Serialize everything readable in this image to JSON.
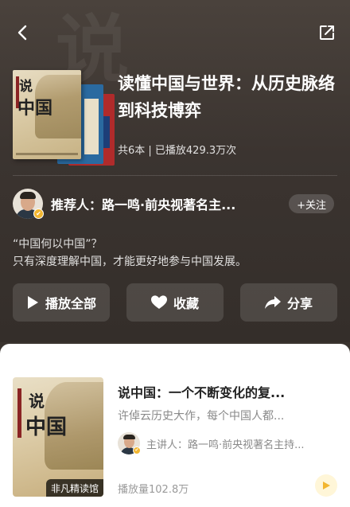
{
  "header": {
    "watermark": "说",
    "back_icon": "chevron-left-icon",
    "share_icon": "share-export-icon"
  },
  "album": {
    "title": "读懂中国与世界：从历史脉络到科技博弈",
    "meta": "共6本 | 已播放429.3万次",
    "cover_title_line1": "说",
    "cover_title_line2": "中国"
  },
  "recommender": {
    "label": "推荐人：路一鸣·前央视著名主...",
    "follow_label": "+关注",
    "badge_icon": "verified-badge-icon"
  },
  "description": {
    "line1": "“中国何以中国”？",
    "line2": "只有深度理解中国，才能更好地参与中国发展。"
  },
  "actions": {
    "play_all": "播放全部",
    "favorite": "收藏",
    "share": "分享"
  },
  "list": {
    "items": [
      {
        "cover_title_line1": "说",
        "cover_title_line2": "中国",
        "cover_tag": "非凡精读馆",
        "title": "说中国：一个不断变化的复...",
        "subtitle": "许倬云历史大作，每个中国人都...",
        "host": "主讲人：路一鸣·前央视著名主持...",
        "plays": "播放量102.8万"
      }
    ]
  },
  "colors": {
    "hero_bg": "#3b3430",
    "accent_yellow": "#f2b630",
    "sheet_bg": "#ffffff"
  }
}
